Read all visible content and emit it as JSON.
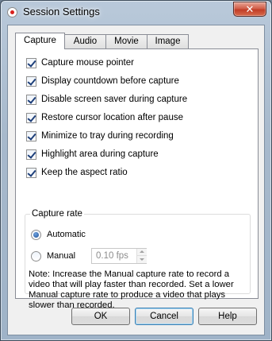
{
  "window": {
    "title": "Session Settings",
    "close_glyph": "✕"
  },
  "tabs": [
    {
      "label": "Capture",
      "active": true
    },
    {
      "label": "Audio",
      "active": false
    },
    {
      "label": "Movie",
      "active": false
    },
    {
      "label": "Image",
      "active": false
    }
  ],
  "options": [
    {
      "label": "Capture mouse pointer",
      "checked": true
    },
    {
      "label": "Display countdown before capture",
      "checked": true
    },
    {
      "label": "Disable screen saver during capture",
      "checked": true
    },
    {
      "label": "Restore cursor location after pause",
      "checked": true
    },
    {
      "label": "Minimize to tray during recording",
      "checked": true
    },
    {
      "label": "Highlight area during capture",
      "checked": true
    },
    {
      "label": "Keep the aspect ratio",
      "checked": true
    }
  ],
  "capture_rate": {
    "title": "Capture rate",
    "automatic_label": "Automatic",
    "manual_label": "Manual",
    "selected": "Automatic",
    "manual_value": "0.10 fps",
    "note": "Note: Increase the Manual capture rate to record a video that will play faster than recorded. Set a lower Manual capture rate to produce a video that plays slower than recorded."
  },
  "buttons": {
    "ok": "OK",
    "cancel": "Cancel",
    "help": "Help"
  },
  "icons": {
    "app": "record-icon",
    "close": "close-icon"
  }
}
